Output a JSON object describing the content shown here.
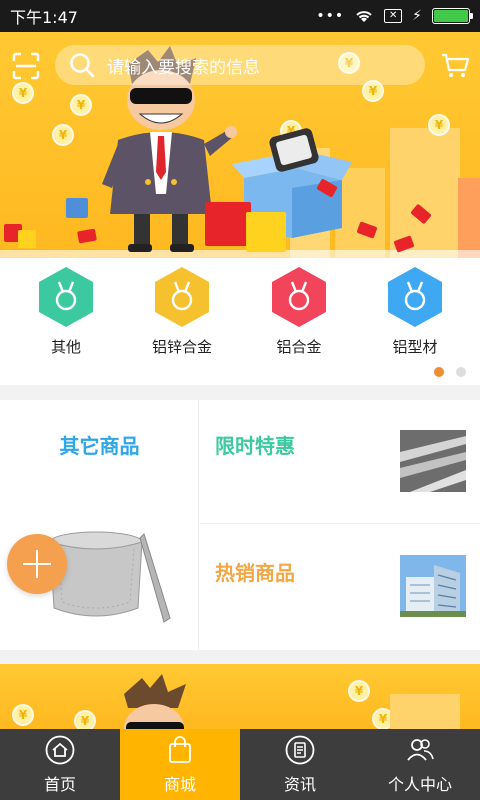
{
  "status_bar": {
    "time": "下午1:47"
  },
  "search": {
    "placeholder": "请输入要搜索的信息"
  },
  "categories": [
    {
      "label": "其他",
      "color": "#3dc9a0"
    },
    {
      "label": "铝锌合金",
      "color": "#f5c12e"
    },
    {
      "label": "铝合金",
      "color": "#f2445a"
    },
    {
      "label": "铝型材",
      "color": "#3fa8f2"
    }
  ],
  "pager": {
    "count": 2,
    "active": 1
  },
  "promo": {
    "left_title": "其它商品",
    "top_right_title": "限时特惠",
    "bottom_right_title": "热销商品"
  },
  "tabbar": {
    "tabs": [
      {
        "label": "首页",
        "icon": "home-icon"
      },
      {
        "label": "商城",
        "icon": "shopping-bag-icon",
        "active": true
      },
      {
        "label": "资讯",
        "icon": "news-icon"
      },
      {
        "label": "个人中心",
        "icon": "user-icon"
      }
    ]
  },
  "colors": {
    "accent": "#ffb400",
    "tabbar_bg": "#3d3d3d",
    "pager_active": "#f08d32"
  }
}
